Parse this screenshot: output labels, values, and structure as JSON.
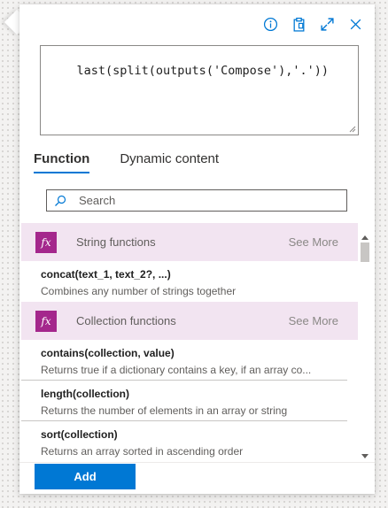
{
  "toolbar": {
    "icons": [
      "info-icon",
      "clipboard-icon",
      "expand-icon",
      "close-icon"
    ]
  },
  "expression": {
    "value": "last(split(outputs('Compose'),'.'))"
  },
  "tabs": [
    {
      "label": "Function",
      "active": true
    },
    {
      "label": "Dynamic content",
      "active": false
    }
  ],
  "search": {
    "placeholder": "Search",
    "value": ""
  },
  "categories": [
    {
      "name": "String functions",
      "see_more": "See More",
      "icon": "fx",
      "items": [
        {
          "signature": "concat(text_1, text_2?, ...)",
          "description": "Combines any number of strings together"
        }
      ]
    },
    {
      "name": "Collection functions",
      "see_more": "See More",
      "icon": "fx",
      "items": [
        {
          "signature": "contains(collection, value)",
          "description": "Returns true if a dictionary contains a key, if an array co..."
        },
        {
          "signature": "length(collection)",
          "description": "Returns the number of elements in an array or string"
        },
        {
          "signature": "sort(collection)",
          "description": "Returns an array sorted in ascending order"
        }
      ]
    }
  ],
  "footer": {
    "add_label": "Add"
  },
  "colors": {
    "accent": "#0078d4",
    "category_bg": "#f2e4f1",
    "fx_badge": "#a4278c"
  }
}
